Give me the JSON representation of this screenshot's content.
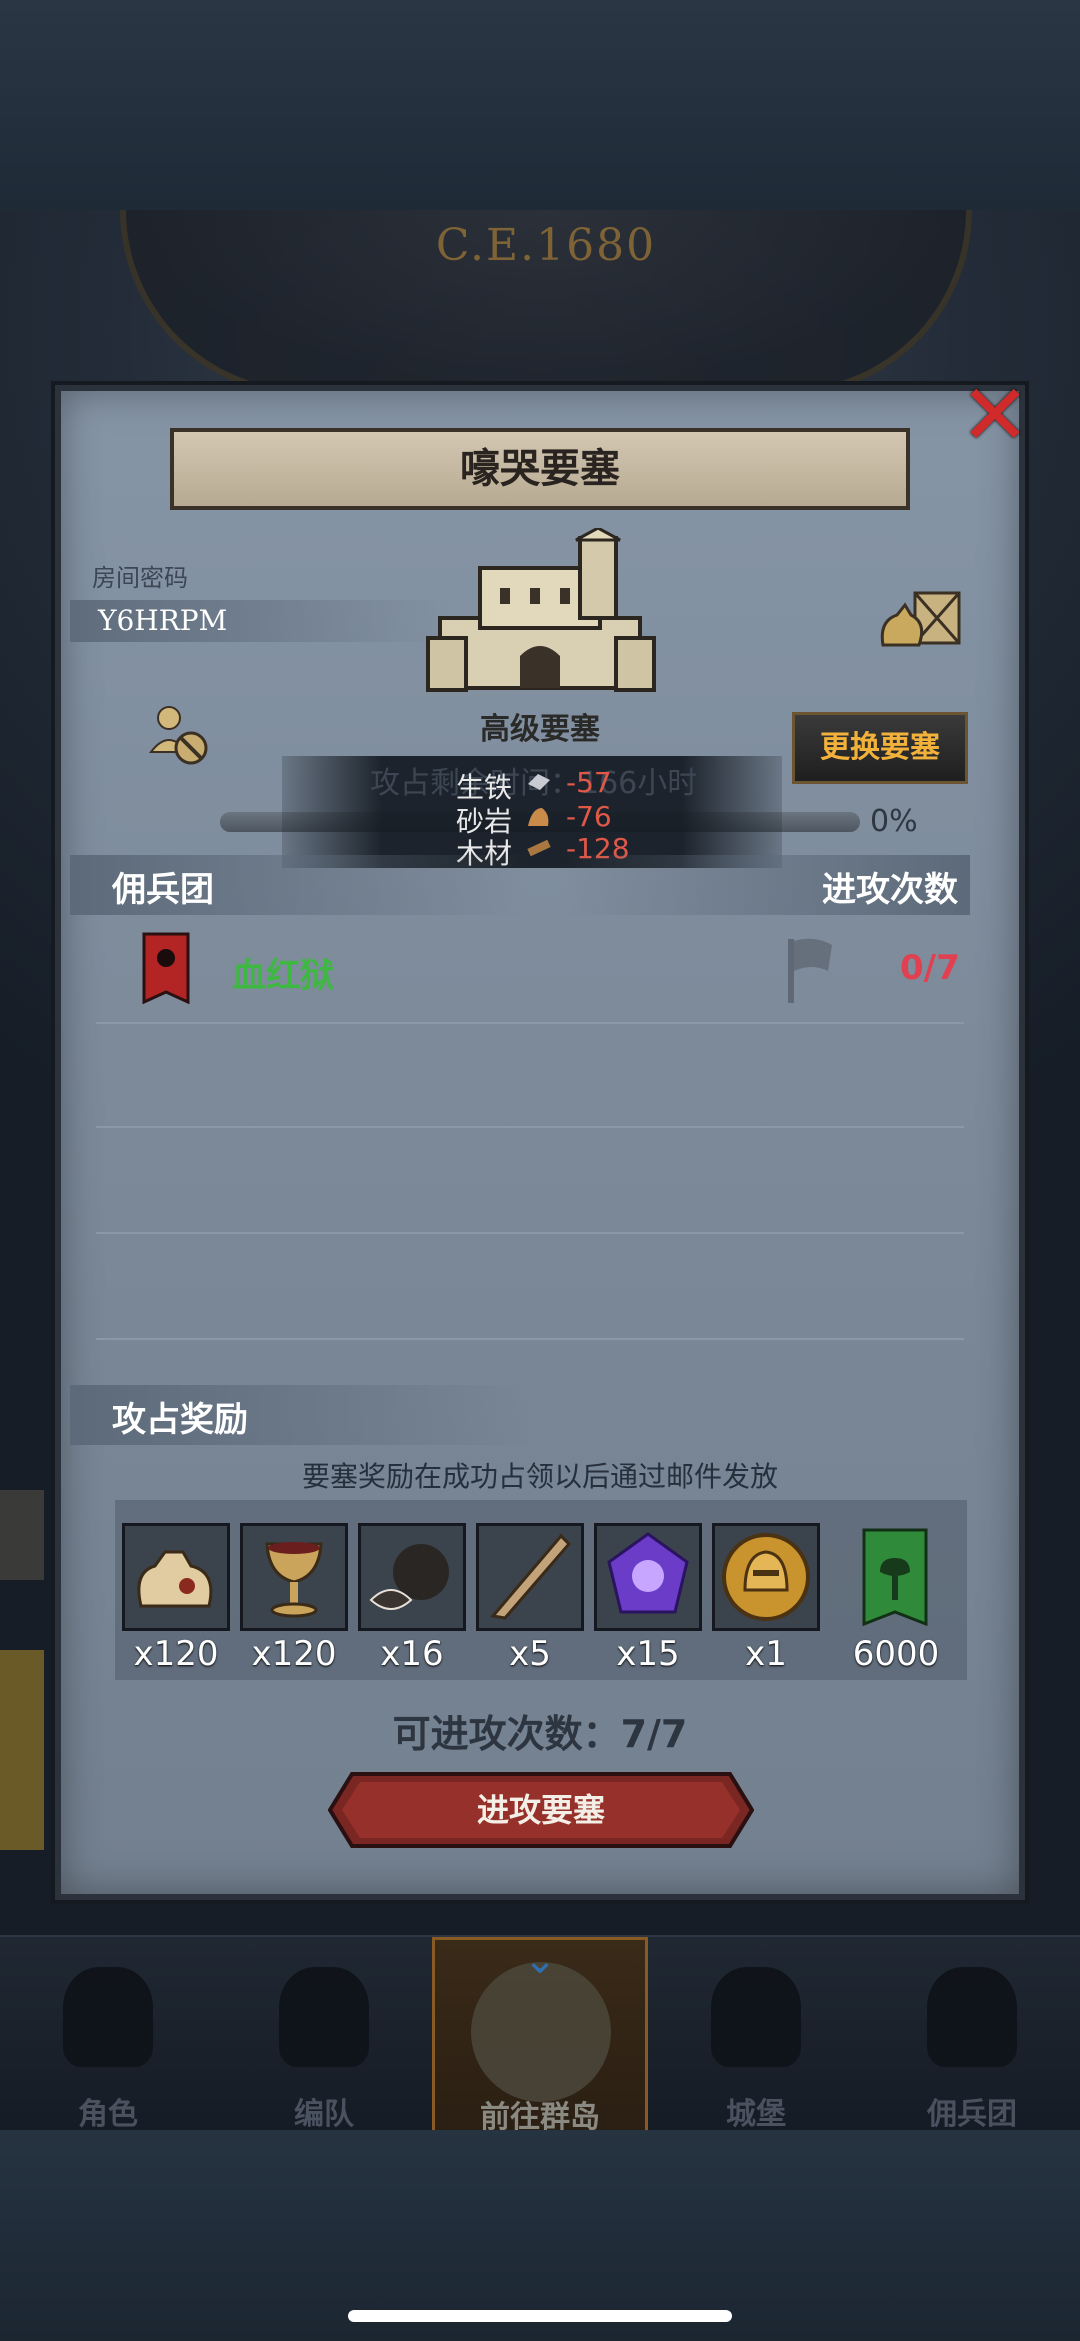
{
  "backdrop": {
    "era": "C.E.1680"
  },
  "modal": {
    "title": "嚎哭要塞",
    "room": {
      "label": "房间密码",
      "code": "Y6HRPM"
    },
    "fortress": {
      "grade": "高级要塞",
      "change_button": "更换要塞"
    },
    "attack_time": "攻占剩余时间：166小时",
    "progress": {
      "percent_label": "0%",
      "value": 0
    },
    "resources": [
      {
        "name": "生铁",
        "value": "-57",
        "icon": "iron-icon"
      },
      {
        "name": "砂岩",
        "value": "-76",
        "icon": "sandstone-icon"
      },
      {
        "name": "木材",
        "value": "-128",
        "icon": "wood-icon"
      }
    ],
    "mercenary_section": {
      "title": "佣兵团",
      "attack_count_header": "进攻次数"
    },
    "mercenaries": [
      {
        "name": "血红狱",
        "count": "0/7"
      }
    ],
    "rewards_section": {
      "title": "攻占奖励",
      "note": "要塞奖励在成功占领以后通过邮件发放",
      "items": [
        {
          "icon": "bag-icon",
          "qty": "x120"
        },
        {
          "icon": "goblet-icon",
          "qty": "x120"
        },
        {
          "icon": "truffle-icon",
          "qty": "x16"
        },
        {
          "icon": "horn-icon",
          "qty": "x5"
        },
        {
          "icon": "purple-gem-icon",
          "qty": "x15"
        },
        {
          "icon": "gold-helmet-coin-icon",
          "qty": "x1"
        },
        {
          "icon": "tree-banner-icon",
          "qty": "6000"
        }
      ]
    },
    "attempts": "可进攻次数：7/7",
    "attack_button": "进攻要塞"
  },
  "nav": {
    "items": [
      {
        "label": "角色",
        "icon": "knight-icon"
      },
      {
        "label": "编队",
        "icon": "helmet-icon"
      },
      {
        "label": "前往群岛",
        "icon": "compass-icon",
        "active": true
      },
      {
        "label": "城堡",
        "icon": "castle-icon"
      },
      {
        "label": "佣兵团",
        "icon": "banner-icon"
      }
    ]
  },
  "colors": {
    "accent_gold": "#f1b13a",
    "mercenary_green": "#3fb843",
    "count_red": "#e04050",
    "resource_negative": "#e05848",
    "close_red": "#d12a2a"
  }
}
